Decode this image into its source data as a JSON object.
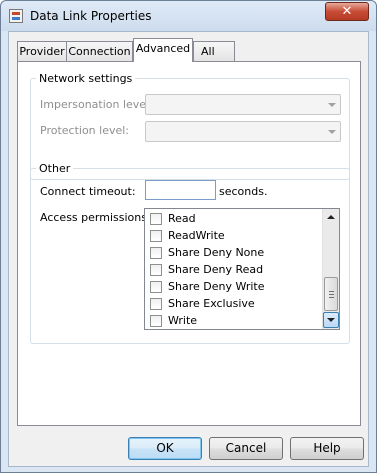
{
  "window": {
    "title": "Data Link Properties"
  },
  "tabs": [
    {
      "label": "Provider",
      "active": false
    },
    {
      "label": "Connection",
      "active": false
    },
    {
      "label": "Advanced",
      "active": true
    },
    {
      "label": "All",
      "active": false
    }
  ],
  "network": {
    "group_label": "Network settings",
    "impersonation_label": "Impersonation level:",
    "impersonation_value": "",
    "protection_label": "Protection level:",
    "protection_value": ""
  },
  "other": {
    "group_label": "Other",
    "timeout_label": "Connect timeout:",
    "timeout_value": "",
    "timeout_unit": "seconds.",
    "access_label": "Access permissions:",
    "permissions": [
      {
        "label": "Read",
        "checked": false
      },
      {
        "label": "ReadWrite",
        "checked": false
      },
      {
        "label": "Share Deny None",
        "checked": false
      },
      {
        "label": "Share Deny Read",
        "checked": false
      },
      {
        "label": "Share Deny Write",
        "checked": false
      },
      {
        "label": "Share Exclusive",
        "checked": false
      },
      {
        "label": "Write",
        "checked": false
      }
    ]
  },
  "buttons": {
    "ok": "OK",
    "cancel": "Cancel",
    "help": "Help"
  },
  "icons": {
    "app": "data-link-icon",
    "close": "close-icon",
    "combo": "chevron-down-icon"
  },
  "colors": {
    "accent": "#3c7fb1",
    "close": "#c84c36"
  }
}
